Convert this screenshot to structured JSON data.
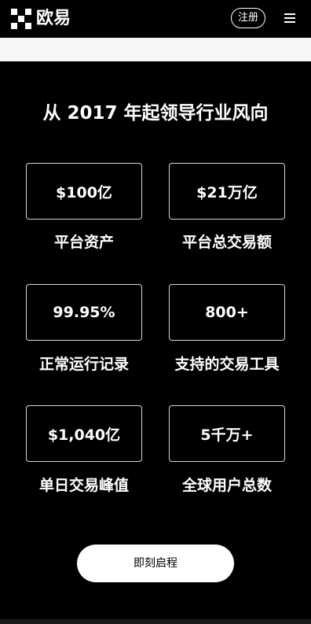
{
  "header": {
    "brand": "欧易",
    "signup_label": "注册",
    "logo_icon": "okx-logo-icon",
    "menu_icon": "hamburger-menu-icon"
  },
  "section": {
    "title": "从 2017 年起领导行业风向"
  },
  "stats": [
    {
      "value": "$100亿",
      "label": "平台资产"
    },
    {
      "value": "$21万亿",
      "label": "平台总交易额"
    },
    {
      "value": "99.95%",
      "label": "正常运行记录"
    },
    {
      "value": "800+",
      "label": "支持的交易工具"
    },
    {
      "value": "$1,040亿",
      "label": "单日交易峰值"
    },
    {
      "value": "5千万+",
      "label": "全球用户总数"
    }
  ],
  "cta": {
    "label": "即刻启程"
  },
  "colors": {
    "background": "#000000",
    "band": "#f7f7f7",
    "cta_background": "#ffffff",
    "border": "#d6d6d6"
  }
}
